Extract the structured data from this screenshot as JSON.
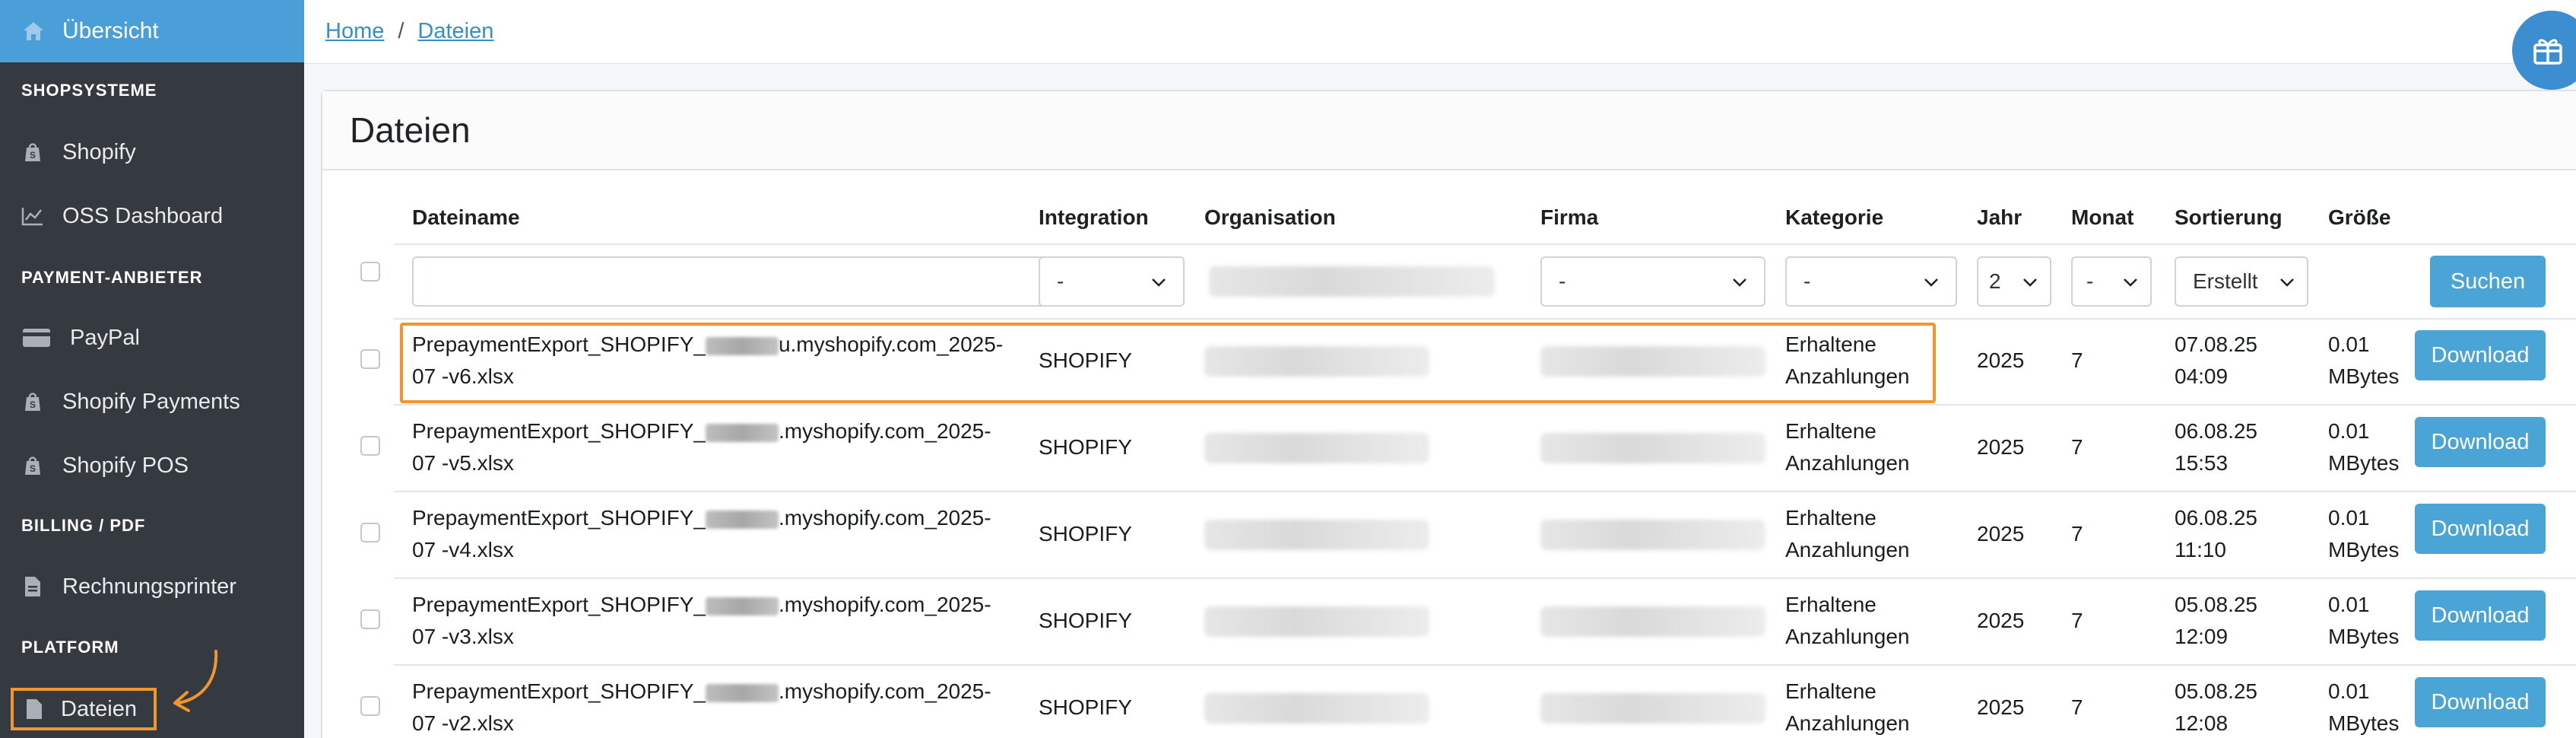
{
  "sidebar": {
    "active_item": {
      "label": "Übersicht",
      "icon": "home-icon"
    },
    "sections": [
      {
        "header": "SHOPSYSTEME",
        "items": [
          {
            "label": "Shopify",
            "icon": "shopify-bag-icon"
          },
          {
            "label": "OSS Dashboard",
            "icon": "chart-line-icon"
          }
        ]
      },
      {
        "header": "PAYMENT-ANBIETER",
        "items": [
          {
            "label": "PayPal",
            "icon": "credit-card-icon"
          },
          {
            "label": "Shopify Payments",
            "icon": "shopify-bag-icon"
          },
          {
            "label": "Shopify POS",
            "icon": "shopify-bag-icon"
          }
        ]
      },
      {
        "header": "BILLING / PDF",
        "items": [
          {
            "label": "Rechnungsprinter",
            "icon": "file-invoice-icon"
          }
        ]
      },
      {
        "header": "PLATFORM",
        "items": [
          {
            "label": "Dateien",
            "icon": "file-icon"
          }
        ]
      }
    ],
    "highlight_color": "#f0962c"
  },
  "breadcrumb": {
    "home": "Home",
    "separator": "/",
    "current": "Dateien"
  },
  "page": {
    "title": "Dateien"
  },
  "table": {
    "columns": [
      "Dateiname",
      "Integration",
      "Organisation",
      "Firma",
      "Kategorie",
      "Jahr",
      "Monat",
      "Sortierung",
      "Größe"
    ],
    "filters": {
      "dateiname": "",
      "integration": "-",
      "firma": "-",
      "kategorie": "-",
      "jahr": "2",
      "monat": "-",
      "sortierung": "Erstellt",
      "search_button": "Suchen"
    },
    "rows": [
      {
        "file_start": "PrepaymentExport_SHOPIFY_",
        "file_mid": "u.myshopify.com_2025-",
        "file_end": "07 -v6.xlsx",
        "integration": "SHOPIFY",
        "kategorie_1": "Erhaltene",
        "kategorie_2": "Anzahlungen",
        "jahr": "2025",
        "monat": "7",
        "date": "07.08.25",
        "time": "04:09",
        "size_1": "0.01",
        "size_2": "MBytes",
        "action": "Download"
      },
      {
        "file_start": "PrepaymentExport_SHOPIFY_",
        "file_mid": ".myshopify.com_2025-",
        "file_end": "07 -v5.xlsx",
        "integration": "SHOPIFY",
        "kategorie_1": "Erhaltene",
        "kategorie_2": "Anzahlungen",
        "jahr": "2025",
        "monat": "7",
        "date": "06.08.25",
        "time": "15:53",
        "size_1": "0.01",
        "size_2": "MBytes",
        "action": "Download"
      },
      {
        "file_start": "PrepaymentExport_SHOPIFY_",
        "file_mid": ".myshopify.com_2025-",
        "file_end": "07 -v4.xlsx",
        "integration": "SHOPIFY",
        "kategorie_1": "Erhaltene",
        "kategorie_2": "Anzahlungen",
        "jahr": "2025",
        "monat": "7",
        "date": "06.08.25",
        "time": "11:10",
        "size_1": "0.01",
        "size_2": "MBytes",
        "action": "Download"
      },
      {
        "file_start": "PrepaymentExport_SHOPIFY_",
        "file_mid": ".myshopify.com_2025-",
        "file_end": "07 -v3.xlsx",
        "integration": "SHOPIFY",
        "kategorie_1": "Erhaltene",
        "kategorie_2": "Anzahlungen",
        "jahr": "2025",
        "monat": "7",
        "date": "05.08.25",
        "time": "12:09",
        "size_1": "0.01",
        "size_2": "MBytes",
        "action": "Download"
      },
      {
        "file_start": "PrepaymentExport_SHOPIFY_",
        "file_mid": ".myshopify.com_2025-",
        "file_end": "07 -v2.xlsx",
        "integration": "SHOPIFY",
        "kategorie_1": "Erhaltene",
        "kategorie_2": "Anzahlungen",
        "jahr": "2025",
        "monat": "7",
        "date": "05.08.25",
        "time": "12:08",
        "size_1": "0.01",
        "size_2": "MBytes",
        "action": "Download"
      }
    ],
    "highlight_color": "#f0962c"
  }
}
